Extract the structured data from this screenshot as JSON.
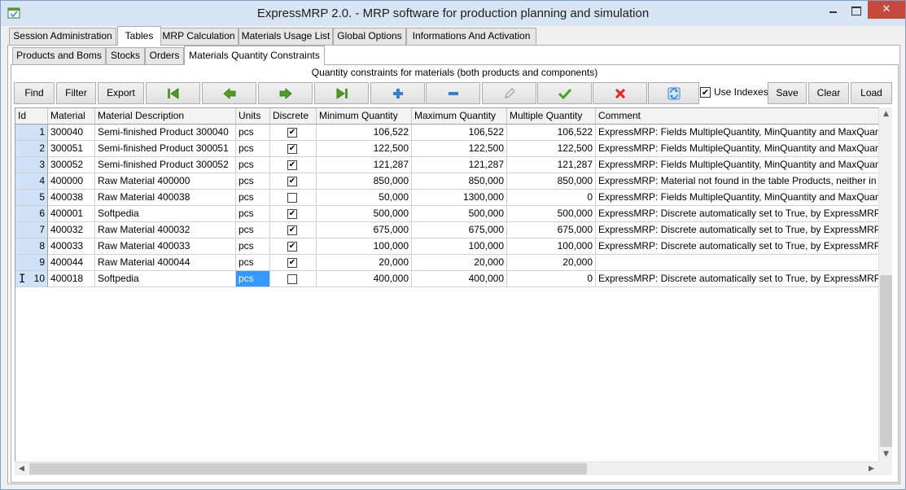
{
  "window": {
    "title": "ExpressMRP 2.0. - MRP software for production planning and simulation",
    "close_glyph": "✕"
  },
  "main_tabs": [
    {
      "label": "Session Administration"
    },
    {
      "label": "Tables"
    },
    {
      "label": "MRP Calculation"
    },
    {
      "label": "Materials Usage List"
    },
    {
      "label": "Global Options"
    },
    {
      "label": "Informations And Activation"
    }
  ],
  "main_tabs_active": "Tables",
  "sub_tabs": [
    {
      "label": "Products and Boms"
    },
    {
      "label": "Stocks"
    },
    {
      "label": "Orders"
    },
    {
      "label": "Materials Quantity Constraints"
    }
  ],
  "sub_tabs_active": "Materials Quantity Constraints",
  "caption": "Quantity constraints for materials (both products and components)",
  "toolbar": {
    "find": "Find",
    "filter": "Filter",
    "export": "Export",
    "first_icon": "first-record-icon",
    "prev_icon": "prev-record-icon",
    "next_icon": "next-record-icon",
    "last_icon": "last-record-icon",
    "add_icon": "plus-icon",
    "remove_icon": "minus-icon",
    "edit_icon": "pencil-icon",
    "confirm_icon": "checkmark-icon",
    "cancel_icon": "x-icon",
    "refresh_icon": "refresh-icon",
    "use_indexes_label": "Use Indexes",
    "use_indexes_checked": true,
    "save": "Save",
    "clear": "Clear",
    "load": "Load"
  },
  "colors": {
    "green_arrow": "#4ca020",
    "blue_plus": "#2f7fd6",
    "red_x": "#e8231c",
    "selection": "#3399ff",
    "id_column": "#cfe2f7"
  },
  "grid": {
    "columns": [
      "Id",
      "Material",
      "Material Description",
      "Units",
      "Discrete",
      "Minimum Quantity",
      "Maximum Quantity",
      "Multiple Quantity",
      "Comment"
    ],
    "rows": [
      {
        "id": "1",
        "material": "300040",
        "description": "Semi-finished Product 300040",
        "units": "pcs",
        "discrete": true,
        "min": "106,522",
        "max": "106,522",
        "multiple": "106,522",
        "comment": "ExpressMRP: Fields MultipleQuantity, MinQuantity and MaxQuantity"
      },
      {
        "id": "2",
        "material": "300051",
        "description": "Semi-finished Product 300051",
        "units": "pcs",
        "discrete": true,
        "min": "122,500",
        "max": "122,500",
        "multiple": "122,500",
        "comment": "ExpressMRP: Fields MultipleQuantity, MinQuantity and MaxQuantity"
      },
      {
        "id": "3",
        "material": "300052",
        "description": "Semi-finished Product 300052",
        "units": "pcs",
        "discrete": true,
        "min": "121,287",
        "max": "121,287",
        "multiple": "121,287",
        "comment": "ExpressMRP: Fields MultipleQuantity, MinQuantity and MaxQuantity"
      },
      {
        "id": "4",
        "material": "400000",
        "description": "Raw Material 400000",
        "units": "pcs",
        "discrete": true,
        "min": "850,000",
        "max": "850,000",
        "multiple": "850,000",
        "comment": "ExpressMRP: Material not found in the table Products, neither in the"
      },
      {
        "id": "5",
        "material": "400038",
        "description": "Raw Material 400038",
        "units": "pcs",
        "discrete": false,
        "min": "50,000",
        "max": "1300,000",
        "multiple": "0",
        "comment": "ExpressMRP: Fields MultipleQuantity, MinQuantity and MaxQuantity"
      },
      {
        "id": "6",
        "material": "400001",
        "description": "Softpedia",
        "units": "pcs",
        "discrete": true,
        "min": "500,000",
        "max": "500,000",
        "multiple": "500,000",
        "comment": "ExpressMRP: Discrete automatically set to True, by ExpressMRP."
      },
      {
        "id": "7",
        "material": "400032",
        "description": "Raw Material 400032",
        "units": "pcs",
        "discrete": true,
        "min": "675,000",
        "max": "675,000",
        "multiple": "675,000",
        "comment": "ExpressMRP: Discrete automatically set to True, by ExpressMRP."
      },
      {
        "id": "8",
        "material": "400033",
        "description": "Raw Material 400033",
        "units": "pcs",
        "discrete": true,
        "min": "100,000",
        "max": "100,000",
        "multiple": "100,000",
        "comment": "ExpressMRP: Discrete automatically set to True, by ExpressMRP."
      },
      {
        "id": "9",
        "material": "400044",
        "description": "Raw Material 400044",
        "units": "pcs",
        "discrete": true,
        "min": "20,000",
        "max": "20,000",
        "multiple": "20,000",
        "comment": ""
      },
      {
        "id": "10",
        "material": "400018",
        "description": "Softpedia",
        "units": "pcs",
        "discrete": false,
        "min": "400,000",
        "max": "400,000",
        "multiple": "0",
        "comment": "ExpressMRP: Discrete automatically set to True, by ExpressMRP.Ex"
      }
    ],
    "selected_row_index": 9,
    "selected_column": "Units",
    "check_glyph": "✔",
    "cursor_glyph": "I"
  },
  "scroll_glyphs": {
    "up": "▲",
    "down": "▼",
    "left": "◀",
    "right": "▶"
  }
}
